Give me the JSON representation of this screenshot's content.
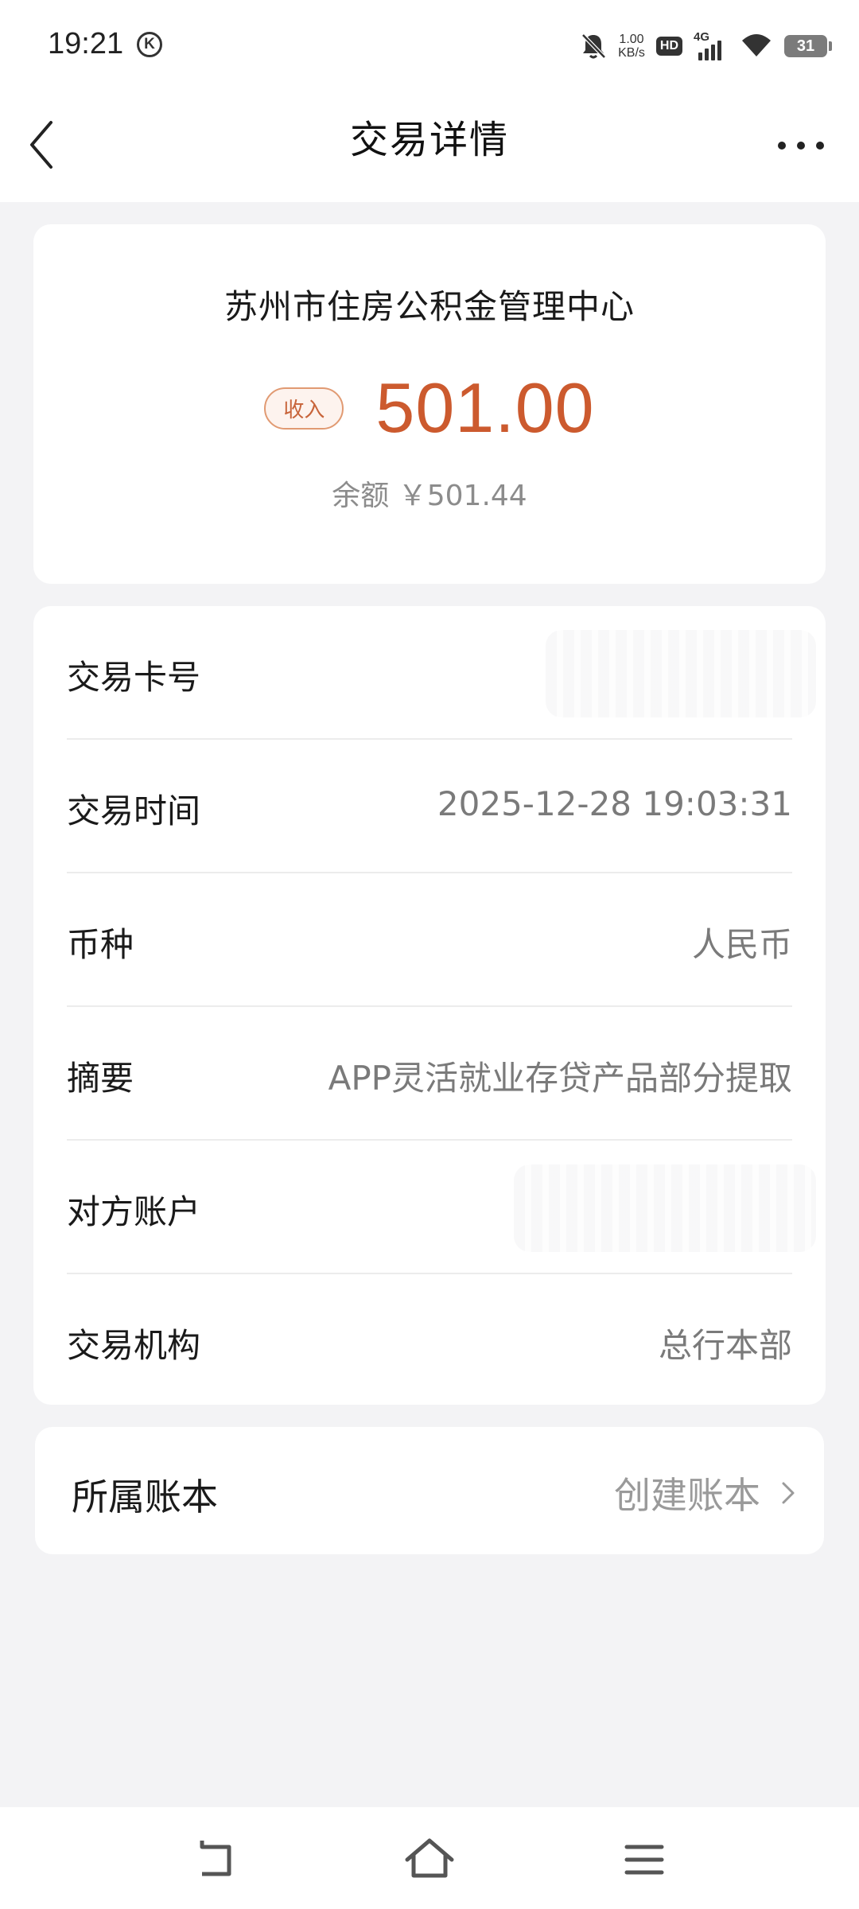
{
  "status_bar": {
    "time": "19:21",
    "k_icon": "K",
    "net_speed_value": "1.00",
    "net_speed_unit": "KB/s",
    "hd_label": "HD",
    "network_label": "4G",
    "battery": "31",
    "icons": [
      "mute-bell-icon",
      "hd-icon",
      "signal-icon",
      "wifi-icon",
      "battery-icon"
    ]
  },
  "nav": {
    "title": "交易详情",
    "back_icon": "chevron-left-icon",
    "more_icon": "more-dots-icon"
  },
  "summary": {
    "payer": "苏州市住房公积金管理中心",
    "badge": "收入",
    "amount": "501.00",
    "balance_label": "余额 ￥501.44",
    "accent_color": "#cc5a2e"
  },
  "details": [
    {
      "label": "交易卡号",
      "value": "",
      "masked": true
    },
    {
      "label": "交易时间",
      "value": "2025-12-28 19:03:31"
    },
    {
      "label": "币种",
      "value": "人民币"
    },
    {
      "label": "摘要",
      "value": "APP灵活就业存贷产品部分提取"
    },
    {
      "label": "对方账户",
      "value": "",
      "masked": true
    },
    {
      "label": "交易机构",
      "value": "总行本部"
    }
  ],
  "ledger": {
    "label": "所属账本",
    "action": "创建账本",
    "action_icon": "chevron-right-icon"
  },
  "system_nav": [
    "back-nav-icon",
    "home-nav-icon",
    "menu-nav-icon"
  ]
}
